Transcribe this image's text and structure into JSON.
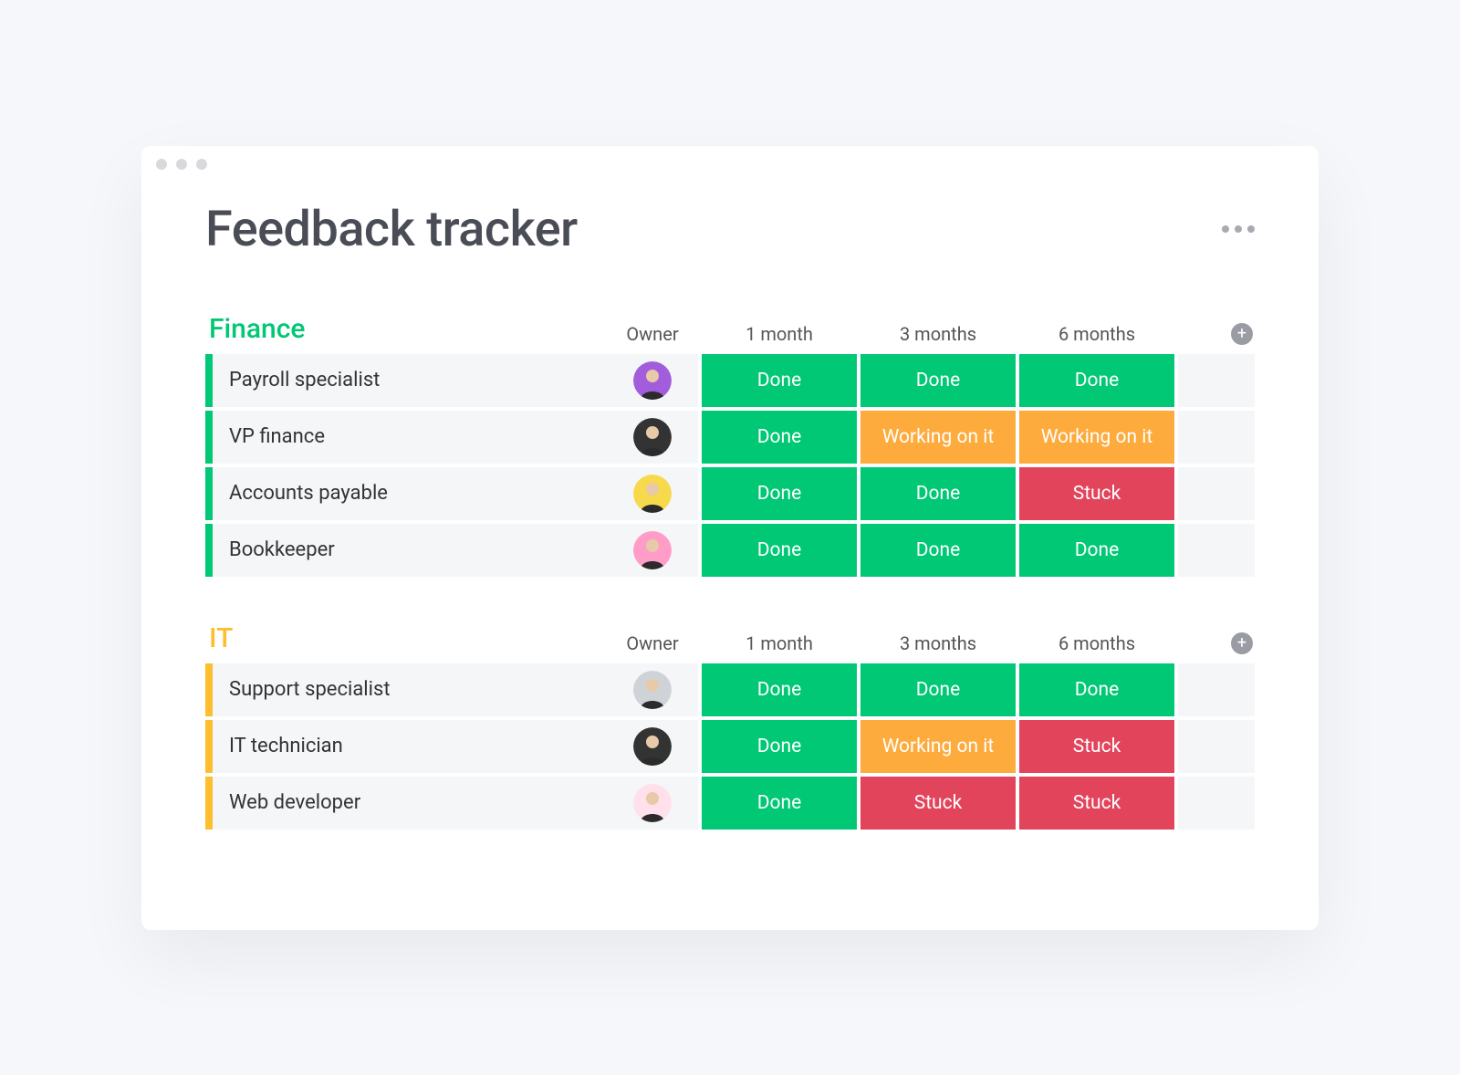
{
  "page": {
    "title": "Feedback tracker"
  },
  "columns": [
    "Owner",
    "1 month",
    "3 months",
    "6 months"
  ],
  "statusPalette": {
    "Done": "#00c875",
    "Working on it": "#fdab3d",
    "Stuck": "#e2445c"
  },
  "avatarBg": [
    "#a25ddc",
    "#333333",
    "#f7d94c",
    "#ff9cc7",
    "#cfd3d8",
    "#333333",
    "#ffe0eb"
  ],
  "groups": [
    {
      "name": "Finance",
      "color": "#00c875",
      "rows": [
        {
          "title": "Payroll specialist",
          "avatar": 0,
          "status": [
            "Done",
            "Done",
            "Done"
          ]
        },
        {
          "title": "VP finance",
          "avatar": 1,
          "status": [
            "Done",
            "Working on it",
            "Working on it"
          ]
        },
        {
          "title": "Accounts payable",
          "avatar": 2,
          "status": [
            "Done",
            "Done",
            "Stuck"
          ]
        },
        {
          "title": "Bookkeeper",
          "avatar": 3,
          "status": [
            "Done",
            "Done",
            "Done"
          ]
        }
      ]
    },
    {
      "name": "IT",
      "color": "#fdbf2d",
      "rows": [
        {
          "title": "Support specialist",
          "avatar": 4,
          "status": [
            "Done",
            "Done",
            "Done"
          ]
        },
        {
          "title": "IT technician",
          "avatar": 5,
          "status": [
            "Done",
            "Working on it",
            "Stuck"
          ]
        },
        {
          "title": "Web developer",
          "avatar": 6,
          "status": [
            "Done",
            "Stuck",
            "Stuck"
          ]
        }
      ]
    }
  ]
}
